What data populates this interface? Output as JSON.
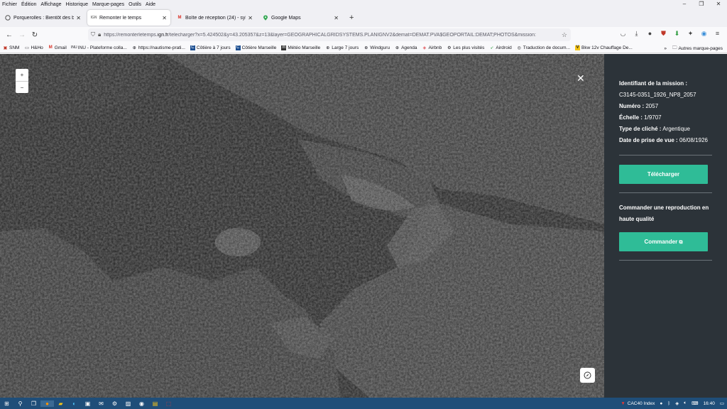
{
  "menubar": {
    "items": [
      "Fichier",
      "Édition",
      "Affichage",
      "Historique",
      "Marque-pages",
      "Outils",
      "Aide"
    ]
  },
  "tabs": [
    {
      "label": "Porquerolles : Bientôt des boué",
      "icon": "chat-bubble-icon",
      "active": false
    },
    {
      "label": "Remonter le temps",
      "icon": "ign-logo-icon",
      "active": true
    },
    {
      "label": "Boîte de réception (24) - sylvie.",
      "icon": "gmail-icon",
      "active": false
    },
    {
      "label": "Google Maps",
      "icon": "map-pin-icon",
      "active": false
    }
  ],
  "navbar": {
    "url_prefix": "https://remonterletemps.",
    "url_domain": "ign.fr",
    "url_suffix": "/telecharger?x=5.424502&y=43.205357&z=13&layer=GEOGRAPHICALGRIDSYSTEMS.PLANIGNV2&demat=DEMAT.PVA$GEOPORTAIL:DEMAT;PHOTOS&mission:"
  },
  "bookmarks": [
    {
      "label": "SNM",
      "icon": "flag-icon"
    },
    {
      "label": "H&Ho",
      "icon": "page-icon"
    },
    {
      "label": "Gmail",
      "icon": "gmail-icon"
    },
    {
      "label": "INU - Plateforme colla...",
      "icon": "inu-icon"
    },
    {
      "label": "https://nautisme-prati...",
      "icon": "globe-icon"
    },
    {
      "label": "Côtière à 7 jours",
      "icon": "c-icon"
    },
    {
      "label": "Côtière Marseille",
      "icon": "c-icon"
    },
    {
      "label": "Météo Marseille",
      "icon": "meteo-icon"
    },
    {
      "label": "Large 7 jours",
      "icon": "globe-icon"
    },
    {
      "label": "Windguru",
      "icon": "globe-icon"
    },
    {
      "label": "Agenda",
      "icon": "globe-icon"
    },
    {
      "label": "Airbnb",
      "icon": "airbnb-icon"
    },
    {
      "label": "Les plus visités",
      "icon": "gear-icon"
    },
    {
      "label": "Airdroid",
      "icon": "airdroid-icon"
    },
    {
      "label": "Traduction de docum...",
      "icon": "translate-icon"
    },
    {
      "label": "Bkw 12v Chauffage De...",
      "icon": "v-icon"
    }
  ],
  "bookmarks_more": "Autres marque-pages",
  "panel": {
    "mission_label": "Identifiant de la mission :",
    "mission_value": "C3145-0351_1926_NP8_2057",
    "numero_label": "Numéro :",
    "numero_value": "2057",
    "echelle_label": "Échelle :",
    "echelle_value": "1/9707",
    "type_label": "Type de cliché :",
    "type_value": "Argentique",
    "date_label": "Date de prise de vue :",
    "date_value": "06/08/1926",
    "download_button": "Télécharger",
    "order_title": "Commander une reproduction en haute qualité",
    "order_button": "Commander"
  },
  "map": {
    "zoom_in": "+",
    "zoom_out": "−"
  },
  "taskbar": {
    "index_label": "CAC40 Index",
    "time": "16:40"
  },
  "colors": {
    "panel_bg": "#2c3339",
    "button_green": "#2fbc97",
    "taskbar_bg": "#1f4e79"
  }
}
